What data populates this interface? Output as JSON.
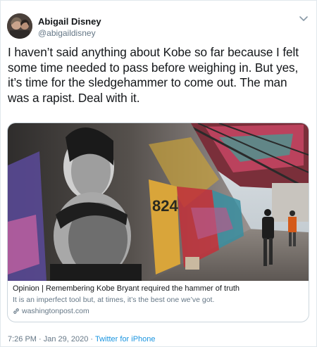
{
  "author": {
    "name": "Abigail Disney",
    "handle": "@abigaildisney"
  },
  "tweet": {
    "text": "I haven’t said anything about Kobe so far because I felt some time needed to pass before weighing in. But yes, it’s time for the sledgehammer to come out. The man was a rapist. Deal with it."
  },
  "card": {
    "title": "Opinion | Remembering Kobe Bryant required the hammer of truth",
    "description": "It is an imperfect tool but, at times, it’s the best one we’ve got.",
    "domain": "washingtonpost.com",
    "image_description_icon": "graffiti-mural-photo"
  },
  "meta": {
    "timestamp": "7:26 PM · Jan 29, 2020",
    "separator": " · ",
    "source": "Twitter for iPhone"
  },
  "icons": {
    "menu": "chevron-down-icon",
    "link": "link-icon"
  },
  "colors": {
    "link": "#1b95e0",
    "secondary_text": "#657786",
    "border": "#ccd6dd"
  }
}
